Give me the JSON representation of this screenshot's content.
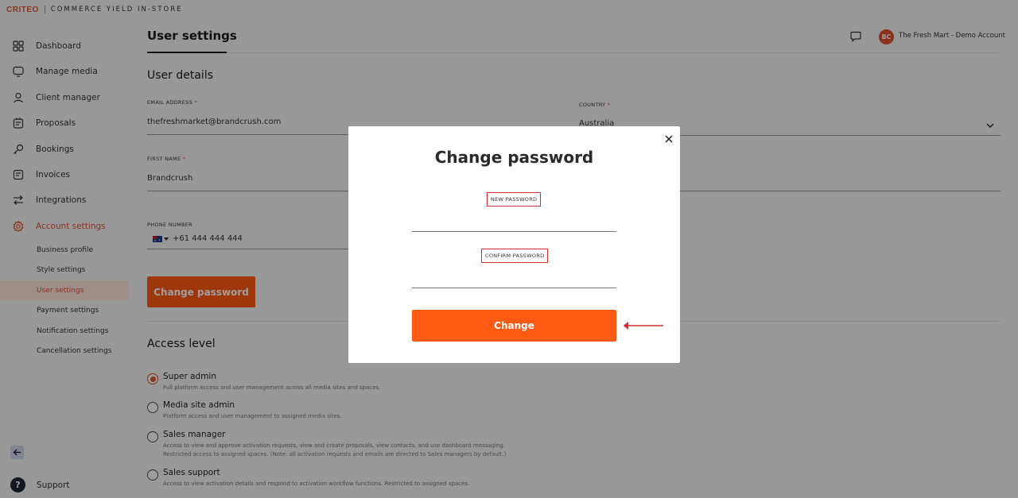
{
  "brand": {
    "logo": "CRITEO",
    "product": "COMMERCE YIELD IN-STORE"
  },
  "sidebar": {
    "items": [
      {
        "label": "Dashboard",
        "icon": "grid-icon"
      },
      {
        "label": "Manage media",
        "icon": "monitor-icon"
      },
      {
        "label": "Client manager",
        "icon": "user-icon"
      },
      {
        "label": "Proposals",
        "icon": "proposal-icon"
      },
      {
        "label": "Bookings",
        "icon": "key-icon"
      },
      {
        "label": "Invoices",
        "icon": "invoice-icon"
      },
      {
        "label": "Integrations",
        "icon": "swap-arrows-icon"
      },
      {
        "label": "Account settings",
        "icon": "gear-icon"
      }
    ],
    "subitems": [
      {
        "label": "Business profile"
      },
      {
        "label": "Style settings"
      },
      {
        "label": "User settings"
      },
      {
        "label": "Payment settings"
      },
      {
        "label": "Notification settings"
      },
      {
        "label": "Cancellation settings"
      }
    ],
    "support_label": "Support",
    "support_icon_text": "?"
  },
  "header": {
    "title": "User settings",
    "avatar_initials": "BC",
    "account_name": "The Fresh Mart - Demo Account"
  },
  "user_details": {
    "title": "User details",
    "email_label": "EMAIL ADDRESS",
    "email_value": "thefreshmarket@brandcrush.com",
    "country_label": "COUNTRY",
    "country_value": "Australia",
    "first_name_label": "FIRST NAME",
    "first_name_value": "Brandcrush",
    "phone_label": "PHONE NUMBER",
    "phone_value": "+61 444 444 444",
    "required_mark": "*",
    "change_password_button": "Change password"
  },
  "access_level": {
    "title": "Access level",
    "options": [
      {
        "label": "Super admin",
        "desc": "Full platform access and user management across all media sites and spaces.",
        "checked": true
      },
      {
        "label": "Media site admin",
        "desc": "Platform access and user management to assigned media sites.",
        "checked": false
      },
      {
        "label": "Sales manager",
        "desc": "Access to view and approve activation requests, view and create proposals, view contacts, and use dashboard messaging.",
        "desc2": "Restricted access to assigned spaces. (Note: all activation requests and emails are directed to Sales managers by default.)",
        "checked": false
      },
      {
        "label": "Sales support",
        "desc": "Access to view activation details and respond to activation workflow functions. Restricted to assigned spaces.",
        "checked": false
      }
    ]
  },
  "modal": {
    "title": "Change password",
    "new_password_label": "NEW PASSWORD",
    "new_password_value": "",
    "confirm_password_label": "CONFIRM PASSWORD",
    "confirm_password_value": "",
    "submit_label": "Change"
  },
  "colors": {
    "accent": "#ff5a14",
    "brand": "#e2502e",
    "highlight": "#d32f2f"
  }
}
